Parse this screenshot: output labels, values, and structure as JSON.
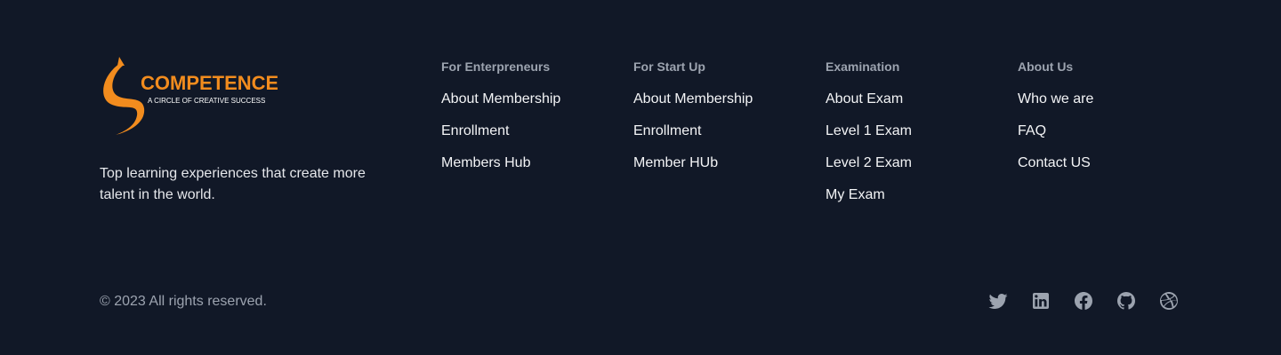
{
  "brand": {
    "logo_name": "COMPETENCE",
    "logo_tagline": "A CIRCLE OF CREATIVE SUCCESS",
    "tagline": "Top learning experiences that create more talent in the world.",
    "colors": {
      "accent": "#f28c1e",
      "background": "#111827"
    }
  },
  "columns": [
    {
      "title": "For Enterpreneurs",
      "links": [
        "About Membership",
        "Enrollment",
        "Members Hub"
      ]
    },
    {
      "title": "For Start Up",
      "links": [
        "About Membership",
        "Enrollment",
        "Member HUb"
      ]
    },
    {
      "title": "Examination",
      "links": [
        "About Exam",
        "Level 1 Exam",
        "Level 2 Exam",
        "My Exam"
      ]
    },
    {
      "title": "About Us",
      "links": [
        "Who we are",
        "FAQ",
        "Contact US"
      ]
    }
  ],
  "copyright": "© 2023 All rights reserved.",
  "social": [
    "twitter-icon",
    "linkedin-icon",
    "facebook-icon",
    "github-icon",
    "dribbble-icon"
  ]
}
